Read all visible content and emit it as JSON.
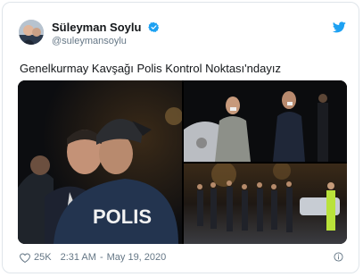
{
  "tweet": {
    "author_name": "Süleyman Soylu",
    "author_handle": "@suleymansoylu",
    "text": "Genelkurmay Kavşağı Polis Kontrol Noktası'ndayız",
    "like_count": "25K",
    "time": "2:31 AM",
    "separator": "-",
    "date": "May 19, 2020",
    "vest_label": "POLIS"
  },
  "icons": {
    "verified": "verified-badge-icon",
    "twitter": "twitter-bird-icon",
    "like": "heart-icon",
    "info": "info-icon"
  },
  "colors": {
    "accent": "#1da1f2",
    "text": "#14171a",
    "muted": "#657786"
  }
}
